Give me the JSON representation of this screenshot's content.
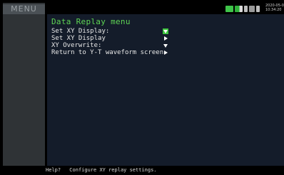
{
  "sidebar": {
    "title": "MENU"
  },
  "header": {
    "datetime_line1": "2020-05-0",
    "datetime_line2": "10:34:20",
    "status_icons": [
      "storage-green-icon",
      "memory-gauge-icon",
      "lock-icon",
      "card-icon",
      "usb-icon"
    ]
  },
  "panel": {
    "title": "Data Replay menu",
    "items": [
      {
        "label": "Set XY Display:",
        "icon": "chevron-down-icon",
        "selected": true
      },
      {
        "label": "Set XY Display",
        "icon": "chevron-right-icon",
        "selected": false
      },
      {
        "label": "XY Overwrite:",
        "icon": "chevron-down-icon",
        "selected": false
      },
      {
        "label": "Return to Y-T waveform screen",
        "icon": "chevron-right-icon",
        "selected": false
      }
    ]
  },
  "help": {
    "prefix": "Help?",
    "message": "Configure XY replay settings."
  },
  "colors": {
    "accent_green": "#5fd454",
    "selected_bg": "#3cc43c",
    "panel_bg": "#141c2a"
  }
}
